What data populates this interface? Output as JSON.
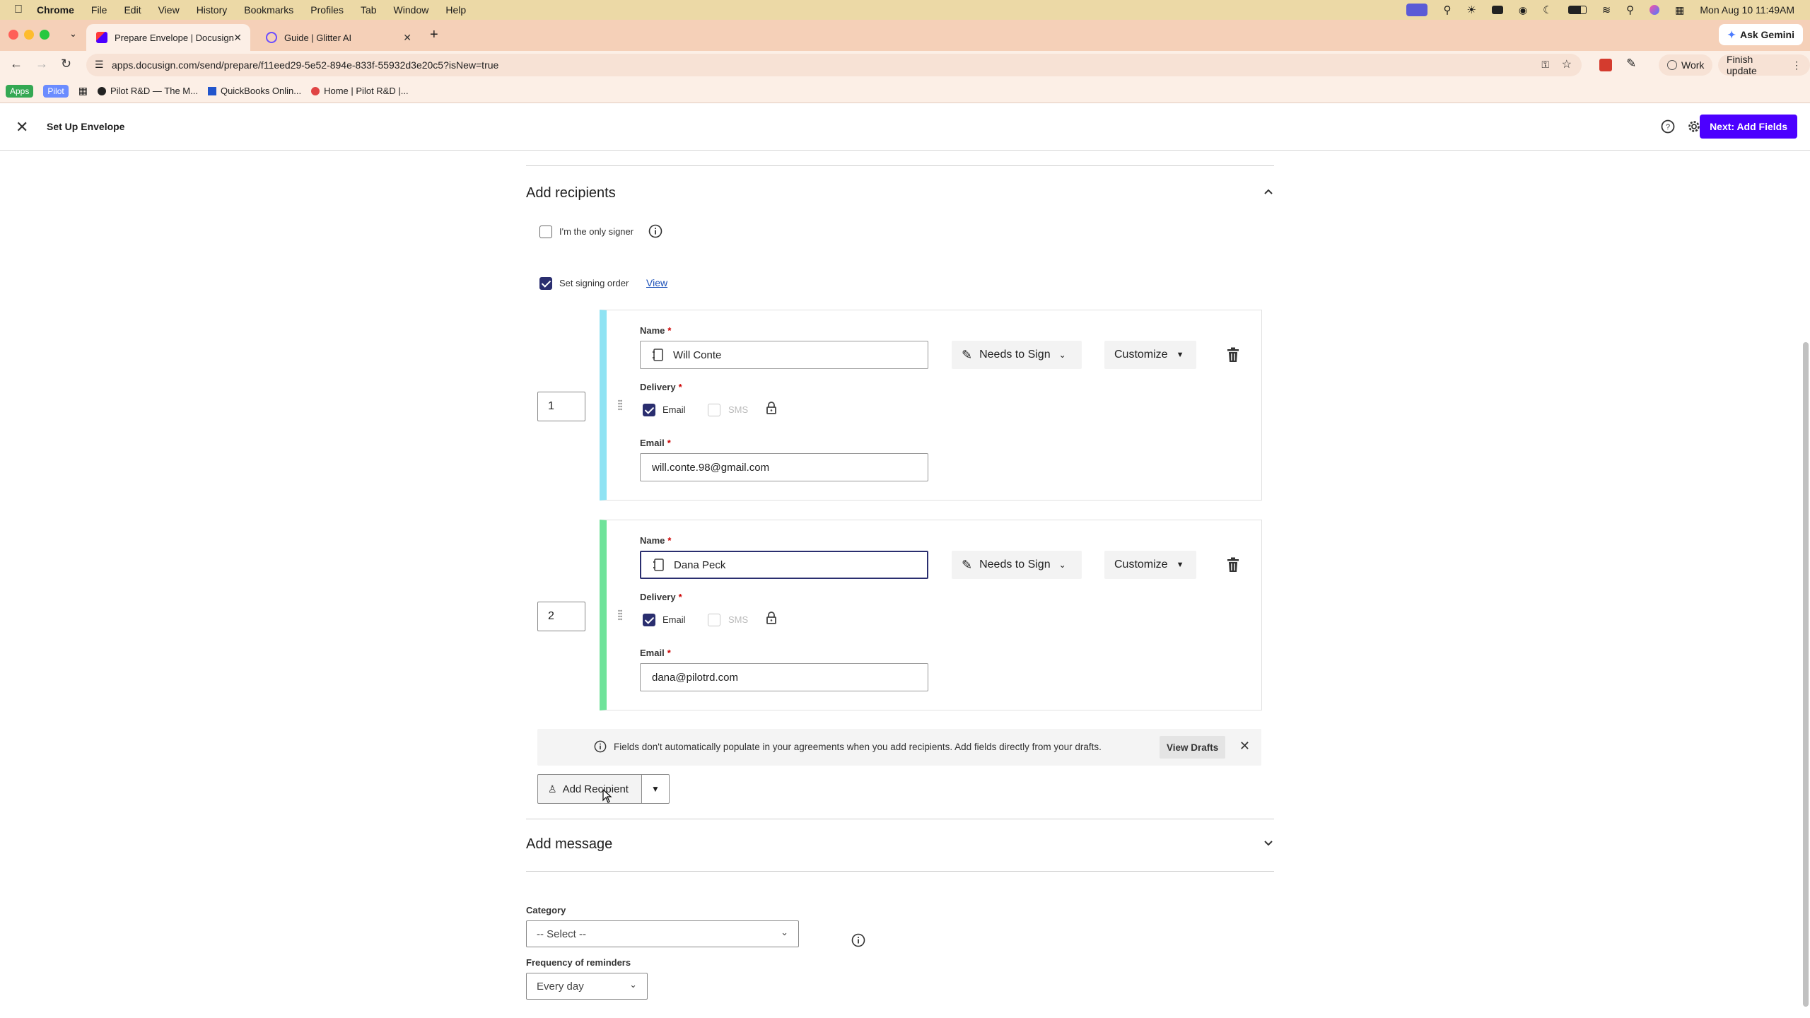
{
  "menubar": {
    "app": "Chrome",
    "items": [
      "File",
      "Edit",
      "View",
      "History",
      "Bookmarks",
      "Profiles",
      "Tab",
      "Window",
      "Help"
    ],
    "clock": "Mon Aug 10  11:49AM"
  },
  "tabs": [
    {
      "title": "Prepare Envelope | Docusign",
      "active": true
    },
    {
      "title": "Guide | Glitter AI",
      "active": false
    }
  ],
  "ask_gemini": "Ask Gemini",
  "address": {
    "url": "apps.docusign.com/send/prepare/f11eed29-5e52-894e-833f-55932d3e20c5?isNew=true",
    "profile": "Work",
    "finish_update": "Finish update"
  },
  "bookmarks": {
    "apps": "Apps",
    "pilot": "Pilot",
    "items": [
      "Pilot R&D — The M...",
      "QuickBooks Onlin...",
      "Home | Pilot R&D |..."
    ]
  },
  "app_header": {
    "title": "Set Up Envelope",
    "next_button": "Next: Add Fields"
  },
  "recipients_section": {
    "title": "Add recipients",
    "only_signer_label": "I'm the only signer",
    "only_signer_checked": false,
    "signing_order_label": "Set signing order",
    "signing_order_checked": true,
    "view_link": "View",
    "name_label": "Name",
    "delivery_label": "Delivery",
    "email_label": "Email",
    "email_option": "Email",
    "sms_option": "SMS",
    "recipients": [
      {
        "order": "1",
        "name": "Will Conte",
        "email": "will.conte.98@gmail.com",
        "action": "Needs to Sign",
        "customize": "Customize",
        "color": "#8fe3f3"
      },
      {
        "order": "2",
        "name": "Dana Peck",
        "email": "dana@pilotrd.com",
        "action": "Needs to Sign",
        "customize": "Customize",
        "color": "#6fe39a"
      }
    ],
    "banner_text": "Fields don't automatically populate in your agreements when you add recipients. Add fields directly from your drafts.",
    "view_drafts": "View Drafts",
    "add_recipient": "Add Recipient"
  },
  "message_section": {
    "title": "Add message",
    "category_label": "Category",
    "category_value": "-- Select --",
    "reminders_label": "Frequency of reminders",
    "reminders_value": "Every day"
  },
  "colors": {
    "accent": "#4c00ff",
    "navy": "#2a2e6f"
  }
}
